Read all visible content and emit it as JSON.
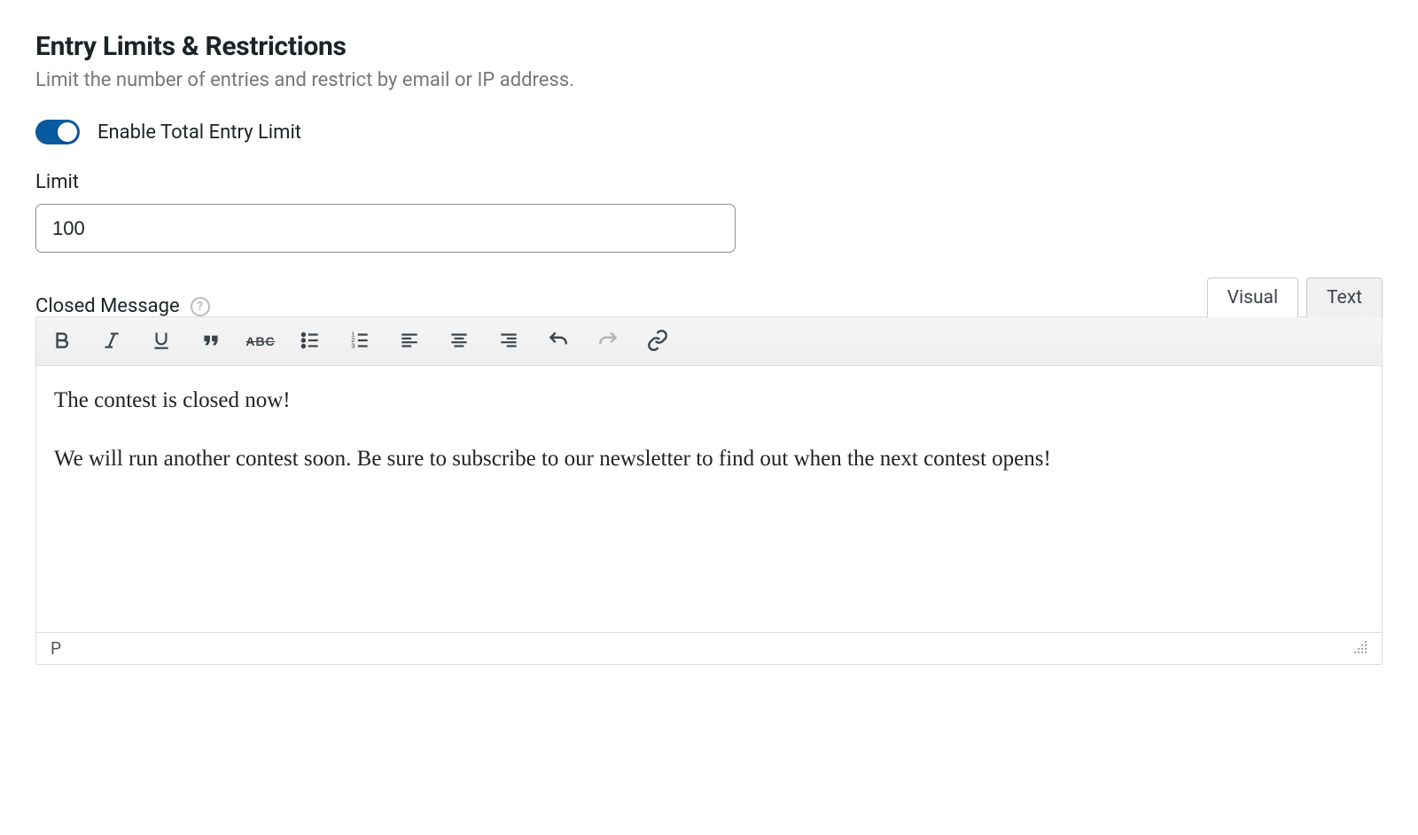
{
  "section": {
    "title": "Entry Limits & Restrictions",
    "subtitle": "Limit the number of entries and restrict by email or IP address."
  },
  "toggle": {
    "label": "Enable Total Entry Limit",
    "enabled": true
  },
  "limit": {
    "label": "Limit",
    "value": "100"
  },
  "closed_message": {
    "label": "Closed Message",
    "help": "?"
  },
  "editor": {
    "tabs": {
      "visual": "Visual",
      "text": "Text"
    },
    "content": {
      "p1": "The contest is closed now!",
      "p2": "We will run another contest soon. Be sure to subscribe to our newsletter to find out when the next contest opens!"
    },
    "statusbar": {
      "path": "P"
    },
    "toolbar_buttons": [
      {
        "name": "bold",
        "label": "Bold"
      },
      {
        "name": "italic",
        "label": "Italic"
      },
      {
        "name": "underline",
        "label": "Underline"
      },
      {
        "name": "blockquote",
        "label": "Blockquote"
      },
      {
        "name": "strikethrough",
        "label": "Strikethrough"
      },
      {
        "name": "bullet-list",
        "label": "Bulleted list"
      },
      {
        "name": "numbered-list",
        "label": "Numbered list"
      },
      {
        "name": "align-left",
        "label": "Align left"
      },
      {
        "name": "align-center",
        "label": "Align center"
      },
      {
        "name": "align-right",
        "label": "Align right"
      },
      {
        "name": "undo",
        "label": "Undo"
      },
      {
        "name": "redo",
        "label": "Redo"
      },
      {
        "name": "link",
        "label": "Insert link"
      }
    ]
  }
}
